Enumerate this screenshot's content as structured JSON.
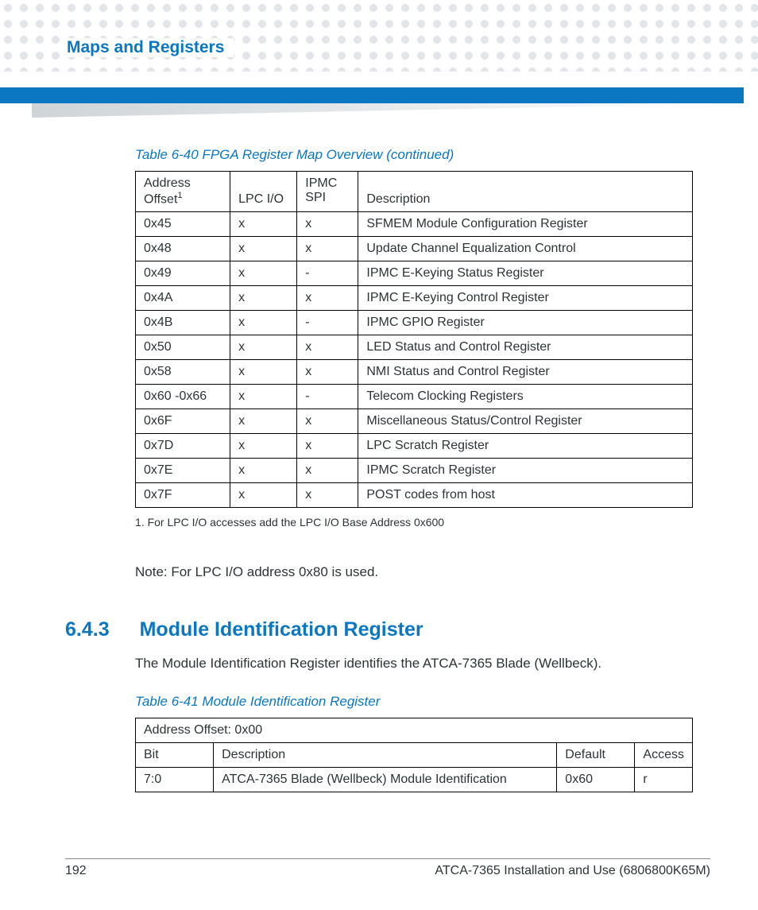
{
  "header": {
    "breadcrumb": "Maps and Registers"
  },
  "table1": {
    "caption": "Table 6-40 FPGA Register Map Overview (continued)",
    "head": {
      "c0a": "Address",
      "c0b": "Offset",
      "c0sup": "1",
      "c1": "LPC I/O",
      "c2a": "IPMC",
      "c2b": "SPI",
      "c3": "Description"
    },
    "rows": [
      {
        "addr": "0x45",
        "lpc": "x",
        "spi": "x",
        "desc": "SFMEM Module Configuration Register"
      },
      {
        "addr": "0x48",
        "lpc": "x",
        "spi": "x",
        "desc": "Update Channel Equalization Control"
      },
      {
        "addr": "0x49",
        "lpc": "x",
        "spi": "-",
        "desc": "IPMC E-Keying Status Register"
      },
      {
        "addr": "0x4A",
        "lpc": "x",
        "spi": "x",
        "desc": "IPMC E-Keying Control Register"
      },
      {
        "addr": "0x4B",
        "lpc": "x",
        "spi": "-",
        "desc": "IPMC GPIO Register"
      },
      {
        "addr": "0x50",
        "lpc": "x",
        "spi": "x",
        "desc": "LED Status and Control Register"
      },
      {
        "addr": "0x58",
        "lpc": "x",
        "spi": "x",
        "desc": "NMI Status and Control Register"
      },
      {
        "addr": "0x60 -0x66",
        "lpc": "x",
        "spi": "-",
        "desc": "Telecom Clocking Registers"
      },
      {
        "addr": "0x6F",
        "lpc": "x",
        "spi": "x",
        "desc": "Miscellaneous Status/Control Register"
      },
      {
        "addr": "0x7D",
        "lpc": "x",
        "spi": "x",
        "desc": "LPC Scratch Register"
      },
      {
        "addr": "0x7E",
        "lpc": "x",
        "spi": "x",
        "desc": "IPMC Scratch Register"
      },
      {
        "addr": "0x7F",
        "lpc": "x",
        "spi": "x",
        "desc": "POST codes from host"
      }
    ],
    "footnote": "1. For LPC I/O accesses add the LPC I/O Base Address 0x600"
  },
  "note": "Note: For LPC I/O address 0x80 is used.",
  "section": {
    "number": "6.4.3",
    "title": "Module Identification Register",
    "desc": "The Module Identification Register identifies the ATCA-7365 Blade (Wellbeck)."
  },
  "table2": {
    "caption": "Table 6-41 Module Identification Register",
    "addr_row": "Address Offset: 0x00",
    "head": {
      "c0": "Bit",
      "c1": "Description",
      "c2": "Default",
      "c3": "Access"
    },
    "row": {
      "bit": "7:0",
      "desc": "ATCA-7365 Blade (Wellbeck) Module Identification",
      "def": "0x60",
      "acc": "r"
    }
  },
  "footer": {
    "page": "192",
    "doc": "ATCA-7365 Installation and Use (6806800K65M)"
  }
}
